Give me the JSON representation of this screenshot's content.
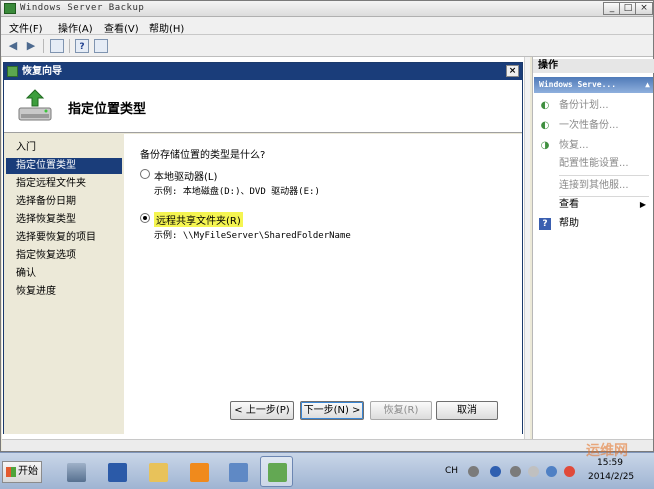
{
  "window": {
    "title": "Windows Server Backup",
    "controls": {
      "minimize": "_",
      "maximize": "□",
      "close": "×"
    }
  },
  "menu": {
    "file": "文件(F)",
    "action": "操作(A)",
    "view": "查看(V)",
    "help": "帮助(H)"
  },
  "toolbar": {
    "back": "◀",
    "forward": "▶",
    "help": "?"
  },
  "actions_pane": {
    "header": "操作",
    "subheader": "Windows Serve...",
    "items": [
      {
        "label": "备份计划...",
        "icon": "backup-schedule-icon",
        "disabled": true
      },
      {
        "label": "一次性备份...",
        "icon": "backup-once-icon",
        "disabled": true
      },
      {
        "label": "恢复...",
        "icon": "recover-icon",
        "disabled": true
      },
      {
        "label": "配置性能设置...",
        "icon": "",
        "disabled": true
      },
      {
        "label": "连接到其他服...",
        "icon": "",
        "disabled": true
      },
      {
        "label": "查看",
        "icon": "",
        "disabled": false
      },
      {
        "label": "帮助",
        "icon": "help-icon",
        "disabled": false
      }
    ]
  },
  "dialog": {
    "title": "恢复向导",
    "close": "×",
    "page_title": "指定位置类型",
    "nav": [
      {
        "label": "入门",
        "active": false
      },
      {
        "label": "指定位置类型",
        "active": true
      },
      {
        "label": "指定远程文件夹",
        "active": false
      },
      {
        "label": "选择备份日期",
        "active": false
      },
      {
        "label": "选择恢复类型",
        "active": false
      },
      {
        "label": "选择要恢复的项目",
        "active": false
      },
      {
        "label": "指定恢复选项",
        "active": false
      },
      {
        "label": "确认",
        "active": false
      },
      {
        "label": "恢复进度",
        "active": false
      }
    ],
    "question": "备份存储位置的类型是什么?",
    "options": [
      {
        "label": "本地驱动器(L)",
        "example": "示例: 本地磁盘(D:)、DVD 驱动器(E:)",
        "checked": false
      },
      {
        "label": "远程共享文件夹(R)",
        "example": "示例: \\\\MyFileServer\\SharedFolderName",
        "checked": true
      }
    ],
    "buttons": {
      "back": "< 上一步(P)",
      "next": "下一步(N) >",
      "recover": "恢复(R)",
      "cancel": "取消"
    }
  },
  "taskbar": {
    "start": "开始",
    "lang": "CH",
    "time": "15:59",
    "date": "2014/2/25",
    "watermark": "运维网"
  }
}
